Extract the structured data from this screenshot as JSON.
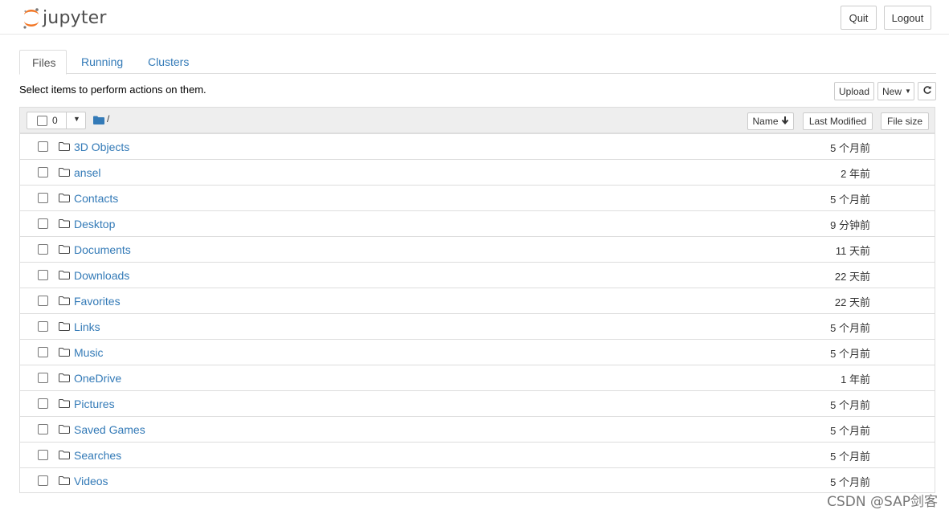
{
  "header": {
    "logo_text": "jupyter",
    "quit_label": "Quit",
    "logout_label": "Logout"
  },
  "tabs": [
    {
      "label": "Files",
      "active": true
    },
    {
      "label": "Running",
      "active": false
    },
    {
      "label": "Clusters",
      "active": false
    }
  ],
  "toolbar": {
    "hint": "Select items to perform actions on them.",
    "upload_label": "Upload",
    "new_label": "New"
  },
  "list_header": {
    "selected_count": "0",
    "path": "/",
    "sort_name": "Name",
    "sort_modified": "Last Modified",
    "sort_size": "File size"
  },
  "files": [
    {
      "name": "3D Objects",
      "modified": "5 个月前"
    },
    {
      "name": "ansel",
      "modified": "2 年前"
    },
    {
      "name": "Contacts",
      "modified": "5 个月前"
    },
    {
      "name": "Desktop",
      "modified": "9 分钟前"
    },
    {
      "name": "Documents",
      "modified": "11 天前"
    },
    {
      "name": "Downloads",
      "modified": "22 天前"
    },
    {
      "name": "Favorites",
      "modified": "22 天前"
    },
    {
      "name": "Links",
      "modified": "5 个月前"
    },
    {
      "name": "Music",
      "modified": "5 个月前"
    },
    {
      "name": "OneDrive",
      "modified": "1 年前"
    },
    {
      "name": "Pictures",
      "modified": "5 个月前"
    },
    {
      "name": "Saved Games",
      "modified": "5 个月前"
    },
    {
      "name": "Searches",
      "modified": "5 个月前"
    },
    {
      "name": "Videos",
      "modified": "5 个月前"
    }
  ],
  "watermark": "CSDN @SAP剑客",
  "colors": {
    "link": "#337ab7",
    "logo_orange": "#f37726"
  }
}
